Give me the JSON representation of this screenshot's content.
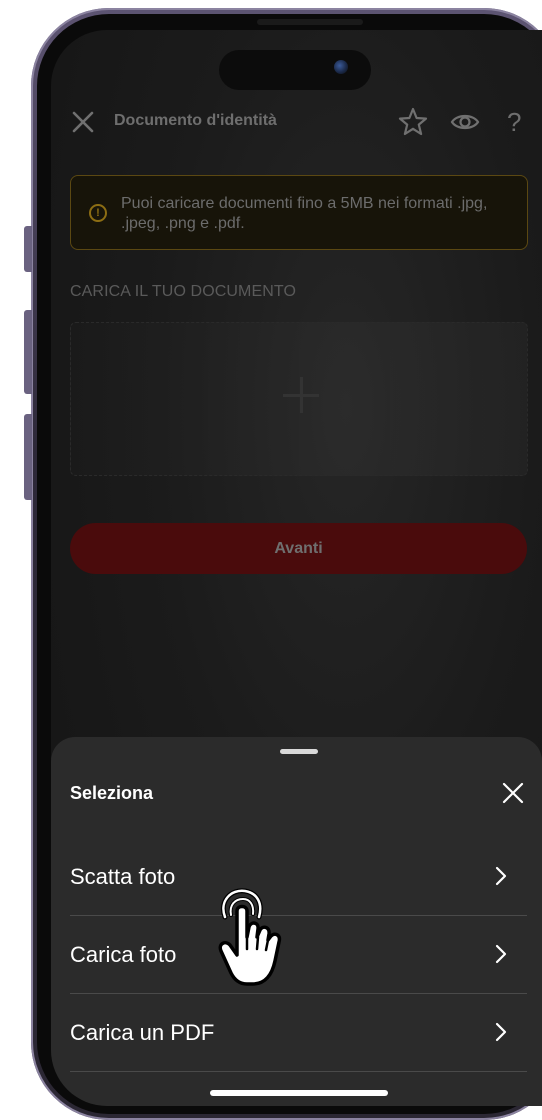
{
  "header": {
    "title": "Documento d'identità",
    "help_label": "?"
  },
  "info": {
    "text": "Puoi caricare documenti fino a 5MB nei formati .jpg, .jpeg, .png e .pdf.",
    "icon_glyph": "!"
  },
  "upload": {
    "section_label": "CARICA IL TUO DOCUMENTO"
  },
  "primary_button": {
    "label": "Avanti"
  },
  "sheet": {
    "title": "Seleziona",
    "options": [
      {
        "label": "Scatta foto"
      },
      {
        "label": "Carica foto"
      },
      {
        "label": "Carica un PDF"
      }
    ]
  },
  "colors": {
    "accent_red": "#4a0b0c",
    "warning_border": "#5b4812",
    "sheet_bg": "#2b2b2b"
  },
  "icons": [
    "close-icon",
    "star-icon",
    "eye-icon",
    "help-icon",
    "info-icon",
    "plus-icon",
    "chevron-right-icon",
    "hand-pointer-icon"
  ]
}
